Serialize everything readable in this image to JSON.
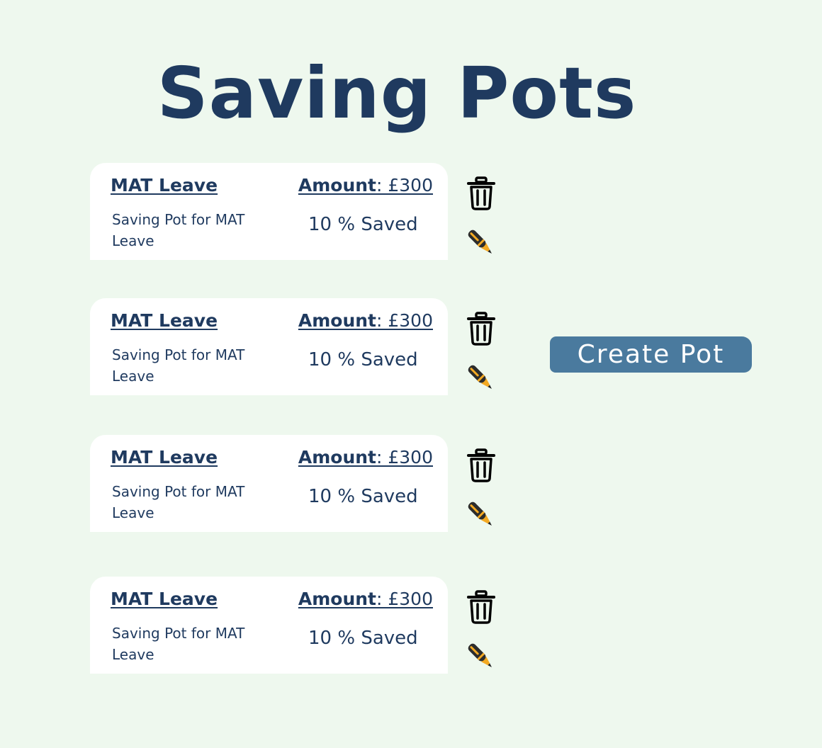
{
  "title": "Saving Pots",
  "create_button": {
    "label": "Create  Pot"
  },
  "icons": {
    "delete": "trash-icon",
    "edit": "pen-icon"
  },
  "colors": {
    "background": "#eef8ee",
    "text": "#1f3a5f",
    "card": "#ffffff",
    "create_button": "#4a7a9e",
    "pen_accent": "#f3a923"
  },
  "pots": [
    {
      "name": "MAT Leave",
      "amount_label": "Amount",
      "amount_value": ": £300",
      "description": "Saving Pot for MAT Leave",
      "progress": "10 % Saved"
    },
    {
      "name": "MAT Leave",
      "amount_label": "Amount",
      "amount_value": ": £300",
      "description": "Saving Pot for MAT Leave",
      "progress": "10 % Saved"
    },
    {
      "name": "MAT Leave",
      "amount_label": "Amount",
      "amount_value": ": £300",
      "description": "Saving Pot for MAT Leave",
      "progress": "10 % Saved"
    },
    {
      "name": "MAT Leave",
      "amount_label": "Amount",
      "amount_value": ": £300",
      "description": "Saving Pot for MAT Leave",
      "progress": "10 % Saved"
    }
  ]
}
